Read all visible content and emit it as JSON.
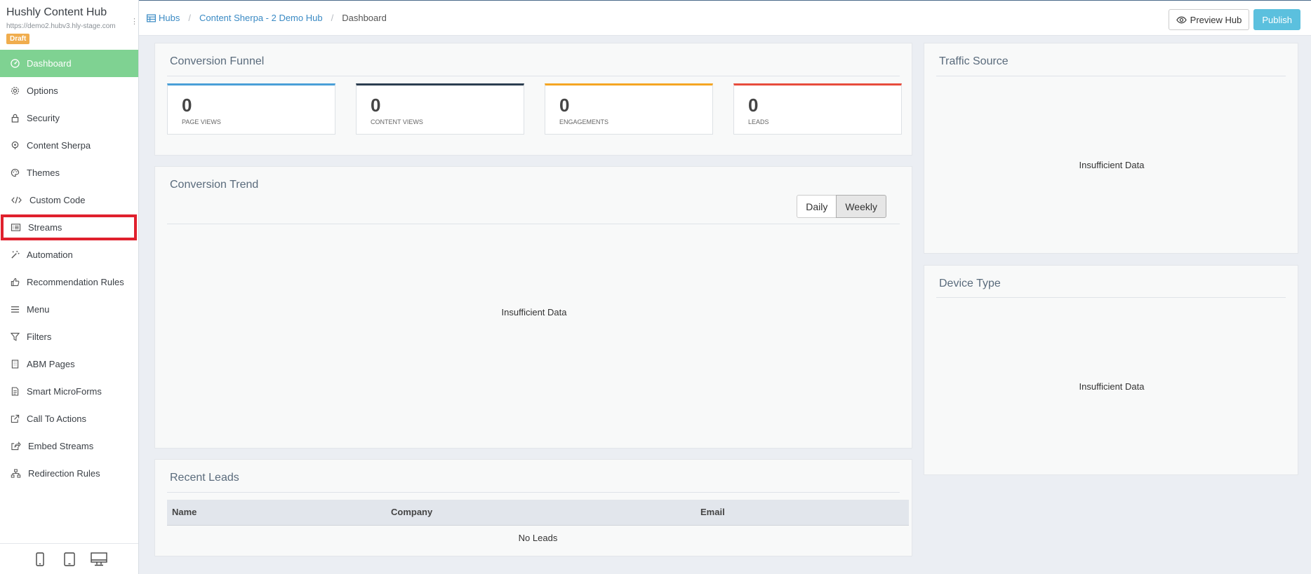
{
  "sidebar": {
    "brand_title": "Hushly Content Hub",
    "brand_url": "https://demo2.hubv3.hly-stage.com",
    "status_badge": "Draft",
    "items": [
      {
        "label": "Dashboard",
        "icon": "dashboard-icon",
        "active": true
      },
      {
        "label": "Options",
        "icon": "gear-icon"
      },
      {
        "label": "Security",
        "icon": "lock-icon"
      },
      {
        "label": "Content Sherpa",
        "icon": "sherpa-icon"
      },
      {
        "label": "Themes",
        "icon": "palette-icon"
      },
      {
        "label": "Custom Code",
        "icon": "code-icon"
      },
      {
        "label": "Streams",
        "icon": "list-icon",
        "highlighted": true
      },
      {
        "label": "Automation",
        "icon": "magic-wand-icon"
      },
      {
        "label": "Recommendation Rules",
        "icon": "thumbs-up-icon"
      },
      {
        "label": "Menu",
        "icon": "bars-icon"
      },
      {
        "label": "Filters",
        "icon": "filter-icon"
      },
      {
        "label": "ABM Pages",
        "icon": "building-icon"
      },
      {
        "label": "Smart MicroForms",
        "icon": "form-icon"
      },
      {
        "label": "Call To Actions",
        "icon": "external-link-icon"
      },
      {
        "label": "Embed Streams",
        "icon": "share-icon"
      },
      {
        "label": "Redirection Rules",
        "icon": "sitemap-icon"
      }
    ],
    "device_buttons": [
      "mobile-icon",
      "tablet-icon",
      "desktop-icon"
    ]
  },
  "header": {
    "breadcrumb": [
      "Hubs",
      "Content Sherpa - 2 Demo Hub",
      "Dashboard"
    ],
    "preview_label": "Preview Hub",
    "publish_label": "Publish"
  },
  "funnel": {
    "title": "Conversion Funnel",
    "stats": [
      {
        "value": "0",
        "label": "PAGE VIEWS",
        "color": "#4a9fd8"
      },
      {
        "value": "0",
        "label": "CONTENT VIEWS",
        "color": "#2c3e50"
      },
      {
        "value": "0",
        "label": "ENGAGEMENTS",
        "color": "#f5a623"
      },
      {
        "value": "0",
        "label": "LEADS",
        "color": "#e74c3c"
      }
    ]
  },
  "trend": {
    "title": "Conversion Trend",
    "toggle": [
      "Daily",
      "Weekly"
    ],
    "active_toggle": "Weekly",
    "empty_text": "Insufficient Data"
  },
  "leads": {
    "title": "Recent Leads",
    "columns": [
      "Name",
      "Company",
      "Email"
    ],
    "empty_text": "No Leads"
  },
  "traffic": {
    "title": "Traffic Source",
    "empty_text": "Insufficient Data"
  },
  "device": {
    "title": "Device Type",
    "empty_text": "Insufficient Data"
  },
  "colors": {
    "active_nav": "#7fd292",
    "highlight": "#e0202d",
    "link": "#3a8ac4",
    "publish": "#5bc0de",
    "draft": "#f0ad4e"
  }
}
